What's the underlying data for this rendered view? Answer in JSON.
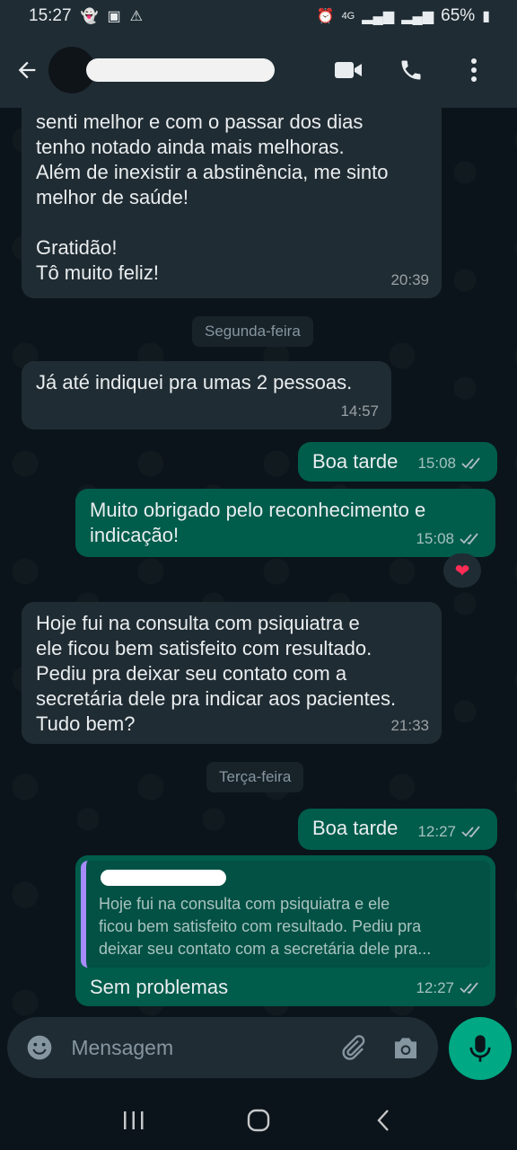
{
  "status_bar": {
    "time": "15:27",
    "battery": "65%",
    "network": "4G"
  },
  "header": {
    "back_icon": "arrow-left-icon",
    "video_icon": "video-camera-icon",
    "call_icon": "phone-icon",
    "menu_icon": "more-vert-icon"
  },
  "messages": [
    {
      "direction": "in",
      "text_lines": [
        "senti melhor e com o passar dos dias",
        "tenho notado ainda mais melhoras.",
        "Além de inexistir a abstinência, me sinto",
        "melhor de saúde!",
        "",
        "Gratidão!",
        "Tô muito feliz!"
      ],
      "time": "20:39"
    },
    {
      "direction": "in",
      "text": "Já até indiquei pra umas 2 pessoas.",
      "time": "14:57"
    },
    {
      "direction": "out",
      "text": "Boa tarde",
      "time": "15:08"
    },
    {
      "direction": "out",
      "text_lines": [
        "Muito obrigado pelo reconhecimento e",
        "indicação!"
      ],
      "time": "15:08",
      "reaction": "❤"
    },
    {
      "direction": "in",
      "text_lines": [
        "Hoje fui na consulta com psiquiatra e",
        "ele ficou bem satisfeito com resultado.",
        "Pediu pra deixar seu contato com a",
        "secretária dele pra indicar aos pacientes.",
        "Tudo bem?"
      ],
      "time": "21:33"
    },
    {
      "direction": "out",
      "text": "Boa tarde",
      "time": "12:27"
    },
    {
      "direction": "out",
      "quoted_lines": [
        "Hoje fui na consulta com psiquiatra e ele",
        "ficou bem satisfeito com resultado. Pediu pra",
        "deixar seu contato com a secretária dele pra..."
      ],
      "text": "Sem problemas",
      "time": "12:27"
    }
  ],
  "day_chips": [
    "Segunda-feira",
    "Terça-feira"
  ],
  "composer": {
    "placeholder": "Mensagem"
  },
  "colors": {
    "incoming": "#202c33",
    "outgoing": "#005c4b",
    "accent": "#00a884",
    "background": "#0b141a"
  }
}
